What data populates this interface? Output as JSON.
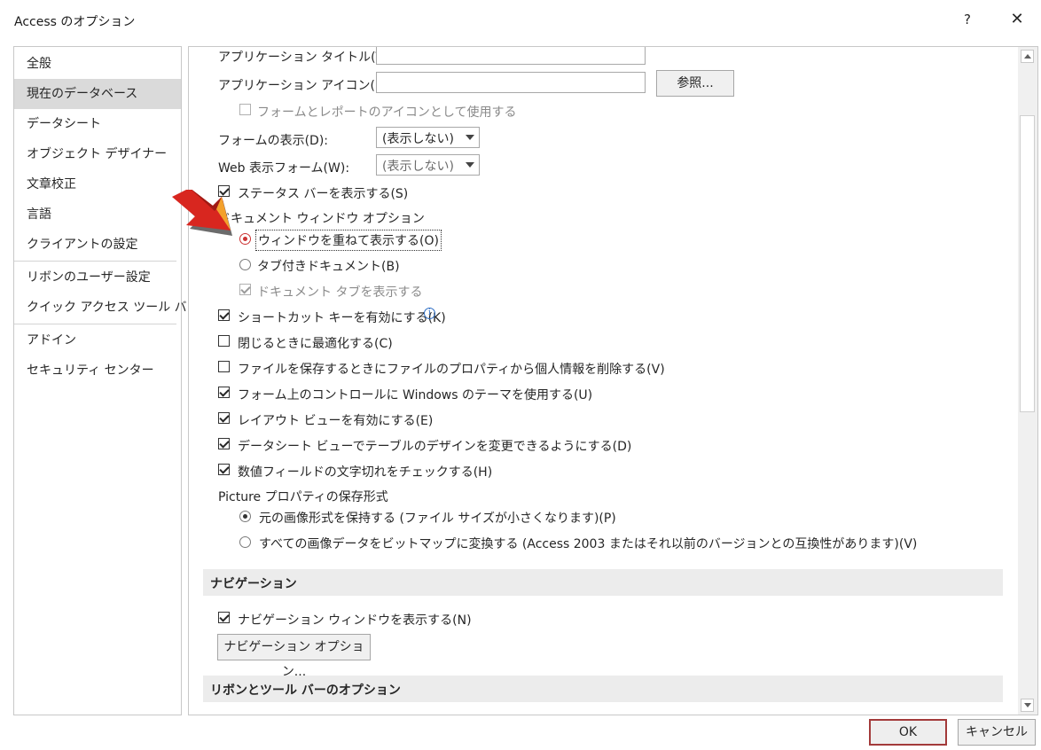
{
  "window": {
    "title": "Access のオプション",
    "help_label": "?",
    "close_label": "✕"
  },
  "sidebar": {
    "items": [
      {
        "label": "全般",
        "selected": false
      },
      {
        "label": "現在のデータベース",
        "selected": true
      },
      {
        "label": "データシート",
        "selected": false
      },
      {
        "label": "オブジェクト デザイナー",
        "selected": false
      },
      {
        "label": "文章校正",
        "selected": false
      },
      {
        "label": "言語",
        "selected": false
      },
      {
        "label": "クライアントの設定",
        "selected": false
      },
      {
        "label": "リボンのユーザー設定",
        "selected": false
      },
      {
        "label": "クイック アクセス ツール バー",
        "selected": false
      },
      {
        "label": "アドイン",
        "selected": false
      },
      {
        "label": "セキュリティ センター",
        "selected": false
      }
    ]
  },
  "content": {
    "app_title_label": "アプリケーション タイトル(T):",
    "app_title_value": "",
    "app_icon_label": "アプリケーション アイコン(I):",
    "app_icon_value": "",
    "browse_button": "参照...",
    "use_icon_forms_label": "フォームとレポートのアイコンとして使用する",
    "display_form_label": "フォームの表示(D):",
    "display_form_value": "(表示しない)",
    "web_display_form_label": "Web 表示フォーム(W):",
    "web_display_form_value": "(表示しない)",
    "status_bar_label": "ステータス バーを表示する(S)",
    "doc_window_options_label": "ドキュメント ウィンドウ オプション",
    "overlapping_windows_label": "ウィンドウを重ねて表示する(O)",
    "tabbed_documents_label": "タブ付きドキュメント(B)",
    "document_tabs_label": "ドキュメント タブを表示する",
    "shortcut_keys_label": "ショートカット キーを有効にする(K)",
    "compact_on_close_label": "閉じるときに最適化する(C)",
    "remove_personal_info_label": "ファイルを保存するときにファイルのプロパティから個人情報を削除する(V)",
    "windows_theme_label": "フォーム上のコントロールに Windows のテーマを使用する(U)",
    "layout_view_label": "レイアウト ビューを有効にする(E)",
    "datasheet_design_label": "データシート ビューでテーブルのデザインを変更できるようにする(D)",
    "truncated_fields_label": "数値フィールドの文字切れをチェックする(H)",
    "picture_storage_label": "Picture プロパティの保存形式",
    "preserve_source_label": "元の画像形式を保持する (ファイル サイズが小さくなります)(P)",
    "convert_bitmap_label": "すべての画像データをビットマップに変換する (Access 2003 またはそれ以前のバージョンとの互換性があります)(V)",
    "nav_section_label": "ナビゲーション",
    "nav_pane_label": "ナビゲーション ウィンドウを表示する(N)",
    "nav_options_button": "ナビゲーション オプション...",
    "ribbon_section_label": "リボンとツール バーのオプション"
  },
  "checks": {
    "use_icon_forms": false,
    "status_bar": true,
    "document_tabs": true,
    "shortcut_keys": true,
    "compact_on_close": false,
    "remove_personal_info": false,
    "windows_theme": true,
    "layout_view": true,
    "datasheet_design": true,
    "truncated_fields": true,
    "nav_pane": true
  },
  "footer": {
    "ok_label": "OK",
    "cancel_label": "キャンセル"
  },
  "colors": {
    "ok_border": "#a33a3a",
    "selected_sidebar": "#dadada",
    "info_icon": "#2b6cc4",
    "annotation_arrow": "#d8261f"
  }
}
